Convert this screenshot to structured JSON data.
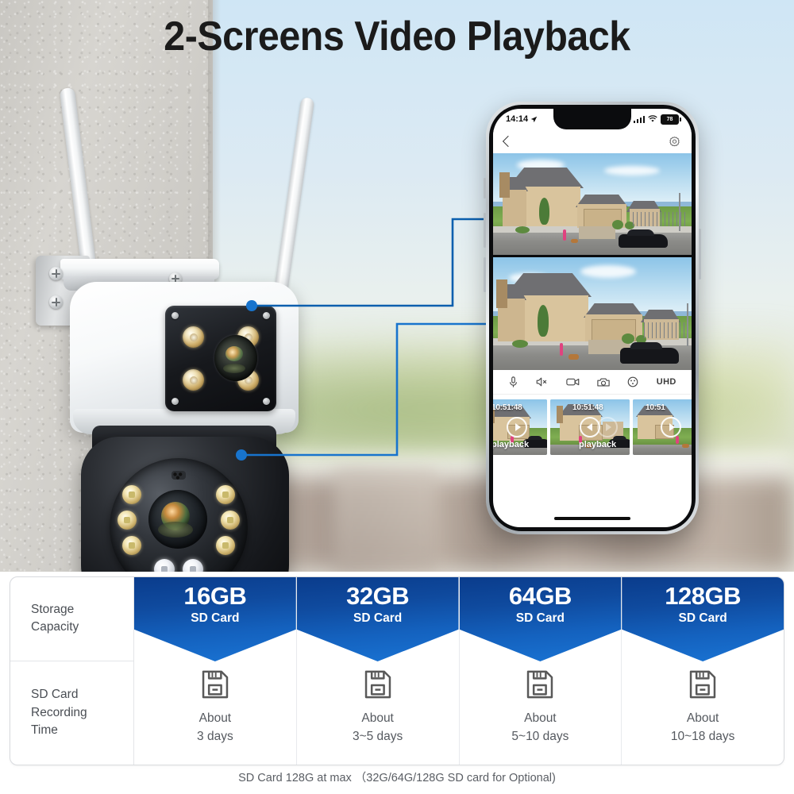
{
  "hero": {
    "title": "2-Screens Video Playback",
    "accent_color": "#1565c0",
    "callout_line_color": "#0a5fae"
  },
  "device": {
    "name": "dual-lens-ptz-wifi-camera",
    "antenna_count": 2,
    "lens_modules": [
      "fixed-wide-lens-module",
      "ptz-dome-lens-module"
    ]
  },
  "phone": {
    "status_bar": {
      "time": "14:14",
      "location_icon": "location-arrow-icon",
      "signal_icon": "cellular-signal-icon",
      "wifi_icon": "wifi-icon",
      "battery_level": "78"
    },
    "nav": {
      "back_icon": "back-chevron-icon",
      "settings_icon": "gear-icon"
    },
    "panes": [
      {
        "name": "wide-angle-live-view",
        "caption": ""
      },
      {
        "name": "telephoto-live-view",
        "caption": ""
      }
    ],
    "controls": [
      {
        "icon": "microphone-icon",
        "label": ""
      },
      {
        "icon": "speaker-mute-icon",
        "label": ""
      },
      {
        "icon": "video-record-icon",
        "label": ""
      },
      {
        "icon": "camera-snapshot-icon",
        "label": ""
      },
      {
        "icon": "more-options-icon",
        "label": ""
      },
      {
        "icon": "resolution-label",
        "label": "UHD"
      }
    ],
    "playback_thumbs": [
      {
        "timestamp": "10:51:48",
        "label": "playback",
        "play_icon": "play-icon"
      },
      {
        "timestamp": "10:51:48",
        "label": "playback",
        "play_icon": "rewind-icon"
      },
      {
        "timestamp": "10:51",
        "label": "",
        "play_icon": "play-icon"
      }
    ]
  },
  "table": {
    "row_labels": [
      "Storage\nCapacity",
      "SD Card\nRecording\nTime"
    ],
    "row_label_1": "Storage Capacity",
    "row_label_2": "SD Card Recording Time",
    "columns": [
      {
        "capacity": "16GB",
        "subtitle": "SD Card",
        "about": "About",
        "duration": "3 days",
        "icon": "sd-card-icon"
      },
      {
        "capacity": "32GB",
        "subtitle": "SD Card",
        "about": "About",
        "duration": "3~5 days",
        "icon": "sd-card-icon"
      },
      {
        "capacity": "64GB",
        "subtitle": "SD Card",
        "about": "About",
        "duration": "5~10 days",
        "icon": "sd-card-icon"
      },
      {
        "capacity": "128GB",
        "subtitle": "SD Card",
        "about": "About",
        "duration": "10~18 days",
        "icon": "sd-card-icon"
      }
    ],
    "banner_gradient_from": "#0a3c8c",
    "banner_gradient_to": "#1a74d4"
  },
  "footer": {
    "note": "SD Card 128G at max （32G/64G/128G SD card for Optional)"
  }
}
